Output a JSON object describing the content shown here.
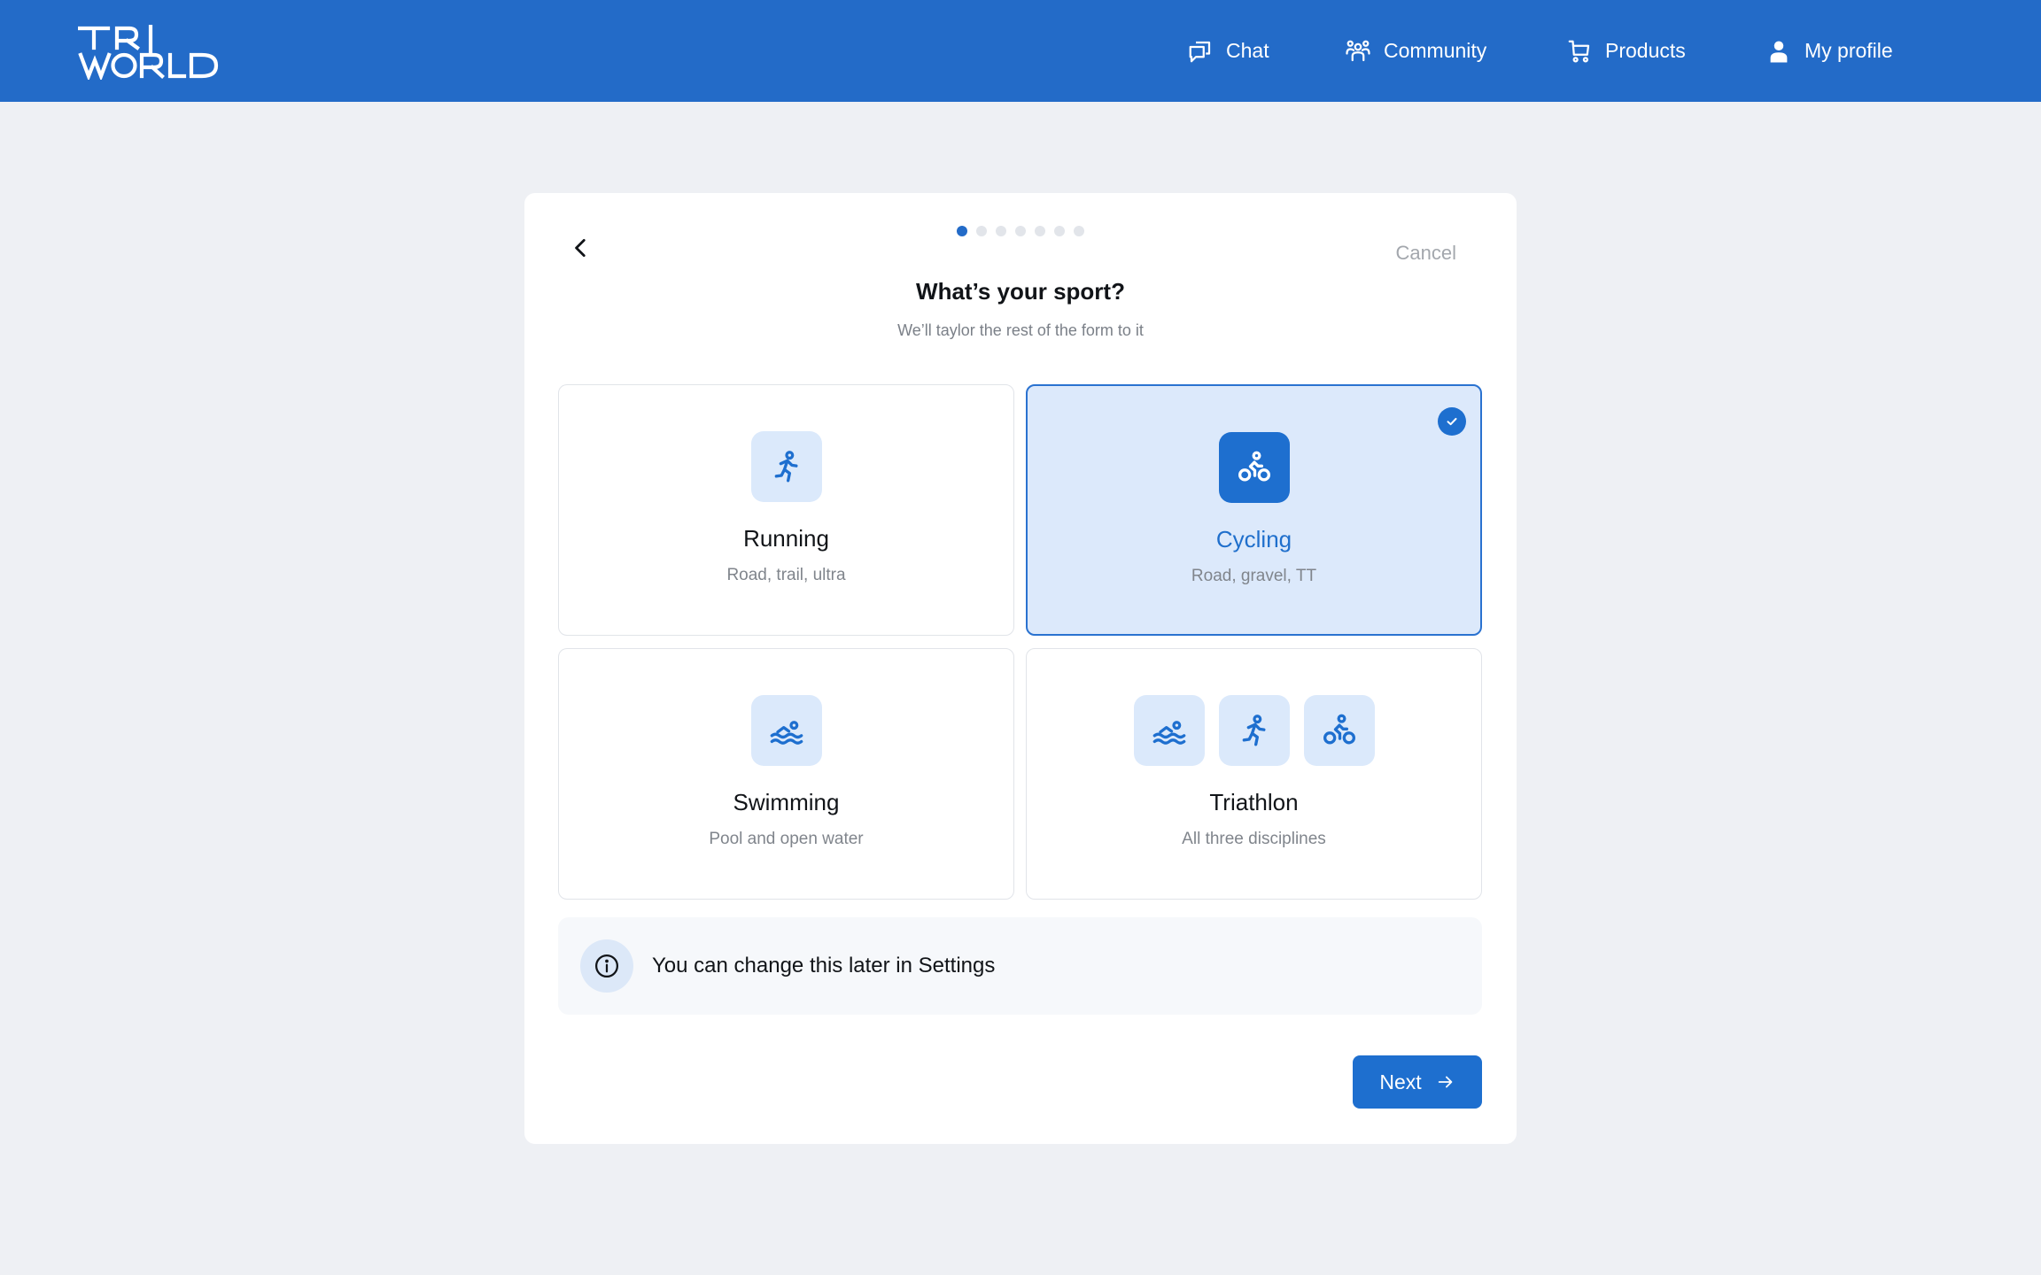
{
  "brand": {
    "logo_text": "TRI WORLD",
    "color": "#236bc8"
  },
  "nav": {
    "items": [
      {
        "label": "Chat",
        "icon": "chat-icon"
      },
      {
        "label": "Community",
        "icon": "community-icon"
      },
      {
        "label": "Products",
        "icon": "cart-icon"
      },
      {
        "label": "My profile",
        "icon": "user-icon"
      }
    ]
  },
  "wizard": {
    "steps_total": 7,
    "current_step": 1,
    "cancel_label": "Cancel",
    "back_icon": "chevron-left-icon",
    "title": "What’s your sport?",
    "subtitle": "We’ll taylor the rest of the form to it",
    "options": [
      {
        "label": "Running",
        "sub": "Road, trail, ultra",
        "selected": false,
        "icons": [
          "running-icon"
        ]
      },
      {
        "label": "Cycling",
        "sub": "Road, gravel, TT",
        "selected": true,
        "icons": [
          "cycling-icon"
        ]
      },
      {
        "label": "Swimming",
        "sub": "Pool and open water",
        "selected": false,
        "icons": [
          "swimming-icon"
        ]
      },
      {
        "label": "Triathlon",
        "sub": "All three disciplines",
        "selected": false,
        "icons": [
          "swimming-icon",
          "running-icon",
          "cycling-icon"
        ]
      }
    ],
    "selected_badge_icon": "check-icon",
    "info_icon": "info-icon",
    "info_text": "You can change this later in Settings",
    "next_label": "Next",
    "next_icon": "arrow-right-icon"
  },
  "colors": {
    "accent": "#1e6fcf",
    "selected_bg": "#dce9fb",
    "page_bg": "#eef0f4"
  }
}
